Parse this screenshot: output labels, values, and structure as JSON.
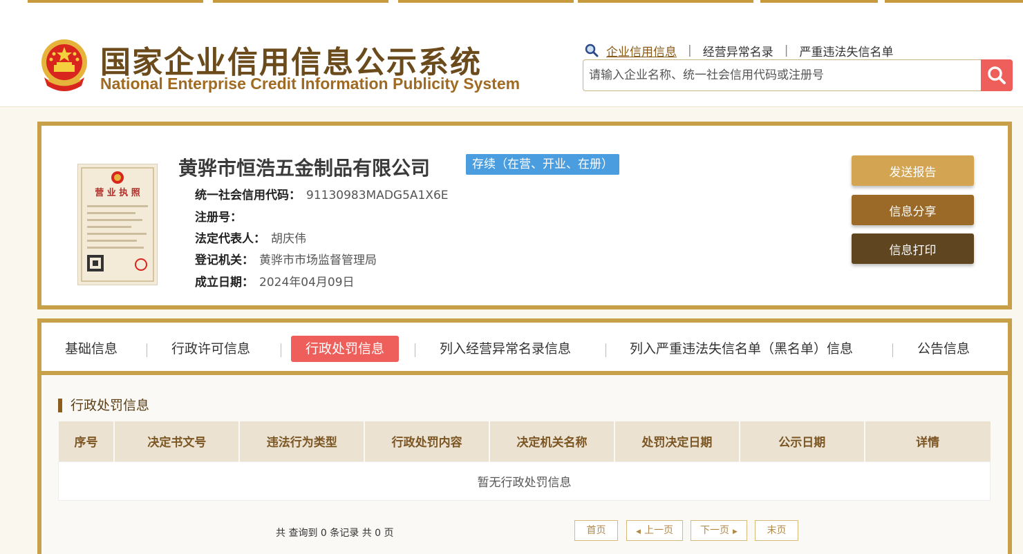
{
  "header": {
    "title": "国家企业信用信息公示系统",
    "subtitle": "National Enterprise Credit Information Publicity System",
    "links": [
      "企业信用信息",
      "经营异常名录",
      "严重违法失信名单"
    ],
    "search_placeholder": "请输入企业名称、统一社会信用代码或注册号"
  },
  "company": {
    "name": "黄骅市恒浩五金制品有限公司",
    "status": "存续（在营、开业、在册）",
    "fields": [
      {
        "label": "统一社会信用代码：",
        "value": "91130983MADG5A1X6E"
      },
      {
        "label": "注册号：",
        "value": ""
      },
      {
        "label": "法定代表人：",
        "value": "胡庆伟"
      },
      {
        "label": "登记机关：",
        "value": "黄骅市市场监督管理局"
      },
      {
        "label": "成立日期：",
        "value": "2024年04月09日"
      }
    ],
    "license_text": "营 业 执 照"
  },
  "actions": {
    "report": "发送报告",
    "share": "信息分享",
    "print": "信息打印"
  },
  "tabs": [
    "基础信息",
    "行政许可信息",
    "行政处罚信息",
    "列入经营异常名录信息",
    "列入严重违法失信名单（黑名单）信息",
    "公告信息"
  ],
  "section": {
    "title": "行政处罚信息",
    "columns": [
      "序号",
      "决定书文号",
      "违法行为类型",
      "行政处罚内容",
      "决定机关名称",
      "处罚决定日期",
      "公示日期",
      "详情"
    ],
    "empty_text": "暂无行政处罚信息"
  },
  "pager": {
    "summary": "共 查询到 0 条记录 共 0 页",
    "first": "首页",
    "prev": "上一页",
    "next": "下一页",
    "last": "末页"
  },
  "colors": {
    "accent_gold": "#c9a04a",
    "active_red": "#ee5f5b",
    "status_blue": "#4a9ee0"
  }
}
